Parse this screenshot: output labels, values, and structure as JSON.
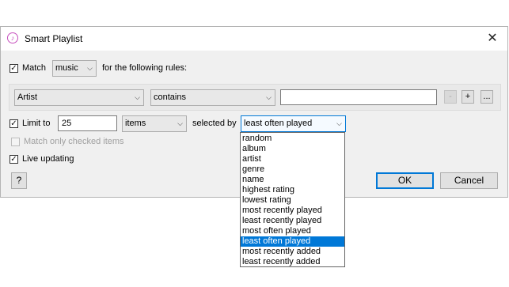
{
  "window": {
    "title": "Smart Playlist",
    "icon": "music-note-icon",
    "close_glyph": "✕"
  },
  "match": {
    "checked": true,
    "label": "Match",
    "media_value": "music",
    "suffix": "for the following rules:"
  },
  "rule": {
    "field_value": "Artist",
    "operator_value": "contains",
    "text_value": "",
    "remove_label": "-",
    "add_label": "+",
    "more_label": "..."
  },
  "limit": {
    "checked": true,
    "label": "Limit to",
    "amount": "25",
    "unit_value": "items",
    "selected_by_label": "selected by",
    "selected_by_value": "least often played",
    "options": [
      "random",
      "album",
      "artist",
      "genre",
      "name",
      "highest rating",
      "lowest rating",
      "most recently played",
      "least recently played",
      "most often played",
      "least often played",
      "most recently added",
      "least recently added"
    ],
    "selected_index": 10
  },
  "match_checked": {
    "checked": false,
    "enabled": false,
    "label": "Match only checked items"
  },
  "live": {
    "checked": true,
    "label": "Live updating"
  },
  "buttons": {
    "help_label": "?",
    "ok_label": "OK",
    "cancel_label": "Cancel"
  },
  "colors": {
    "accent": "#0078d7",
    "dialog_bg": "#f0f0f0",
    "icon_color": "#c64fbd"
  }
}
